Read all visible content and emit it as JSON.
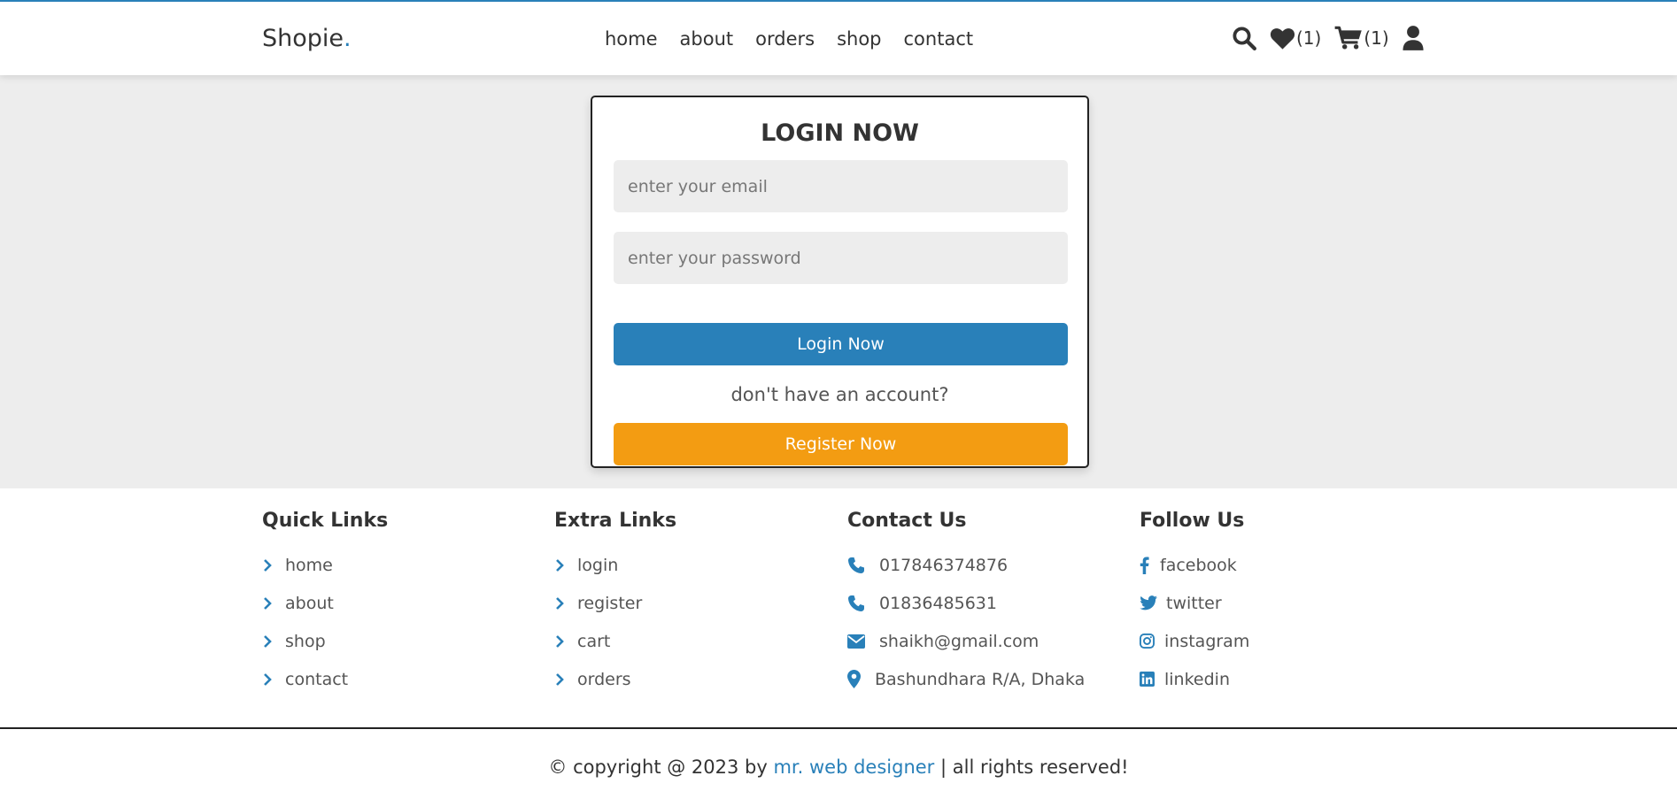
{
  "header": {
    "logo": "Shopie",
    "logo_dot": ".",
    "nav": [
      "home",
      "about",
      "orders",
      "shop",
      "contact"
    ],
    "icons": {
      "search": "search-icon",
      "wishlist": "heart-icon",
      "wishlist_count": "(1)",
      "cart": "cart-icon",
      "cart_count": "(1)",
      "user": "user-icon"
    }
  },
  "login": {
    "title": "LOGIN NOW",
    "email_placeholder": "enter your email",
    "password_placeholder": "enter your password",
    "login_button": "Login Now",
    "prompt": "don't have an account?",
    "register_button": "Register Now"
  },
  "footer": {
    "quick_links": {
      "title": "Quick Links",
      "items": [
        "home",
        "about",
        "shop",
        "contact"
      ]
    },
    "extra_links": {
      "title": "Extra Links",
      "items": [
        "login",
        "register",
        "cart",
        "orders"
      ]
    },
    "contact": {
      "title": "Contact Us",
      "items": [
        {
          "icon": "phone-icon",
          "text": "017846374876"
        },
        {
          "icon": "phone-icon",
          "text": "01836485631"
        },
        {
          "icon": "envelope-icon",
          "text": "shaikh@gmail.com"
        },
        {
          "icon": "map-marker-icon",
          "text": "Bashundhara R/A, Dhaka"
        }
      ]
    },
    "follow": {
      "title": "Follow Us",
      "items": [
        {
          "icon": "facebook-icon",
          "text": "facebook"
        },
        {
          "icon": "twitter-icon",
          "text": "twitter"
        },
        {
          "icon": "instagram-icon",
          "text": "instagram"
        },
        {
          "icon": "linkedin-icon",
          "text": "linkedin"
        }
      ]
    },
    "credit": {
      "prefix": "© copyright @ 2023 by ",
      "author": "mr. web designer",
      "suffix": " | all rights reserved!"
    }
  },
  "colors": {
    "accent": "#2980b9",
    "register": "#f39c12",
    "page_bg": "#ededed"
  }
}
